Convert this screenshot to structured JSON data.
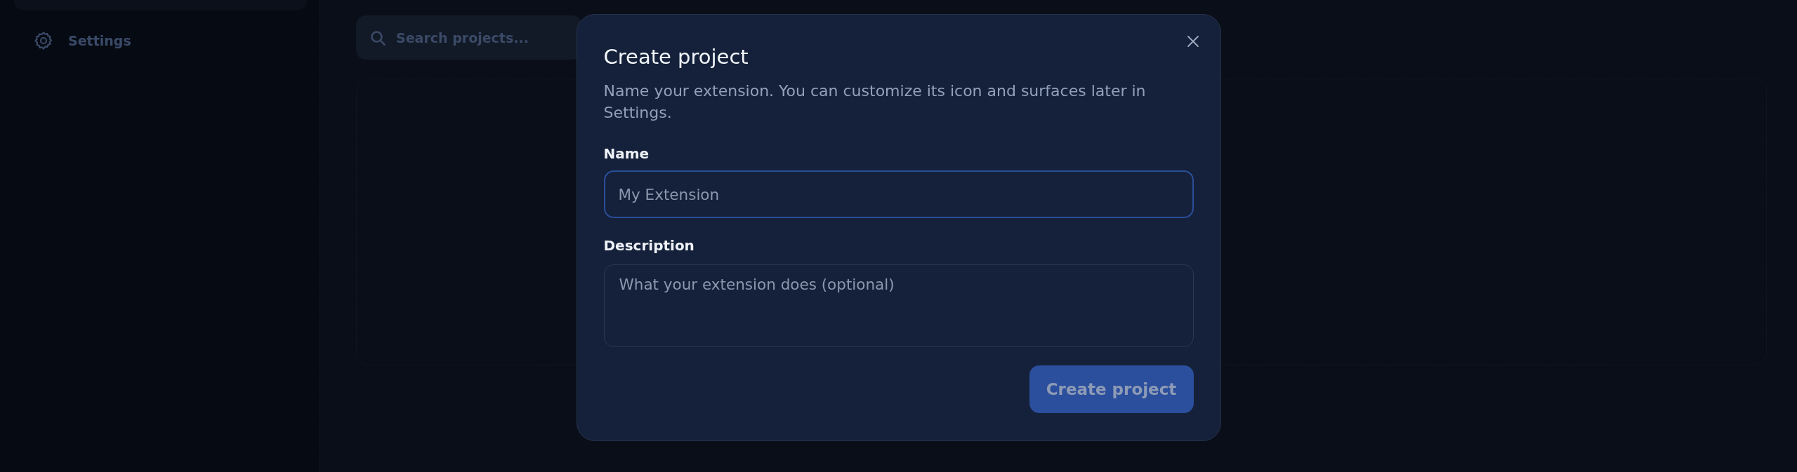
{
  "sidebar": {
    "items": [
      {
        "label": "Settings",
        "selected": false
      }
    ]
  },
  "search": {
    "placeholder": "Search projects..."
  },
  "dialog": {
    "title": "Create project",
    "description": "Name your extension. You can customize its icon and surfaces later in Settings.",
    "fields": [
      {
        "kind": "input",
        "label": "Name",
        "placeholder": "My Extension",
        "focused": true
      },
      {
        "kind": "textarea",
        "label": "Description",
        "placeholder": "What your extension does (optional)",
        "focused": false
      }
    ],
    "submit": {
      "label": "Create project",
      "disabled": true
    }
  }
}
